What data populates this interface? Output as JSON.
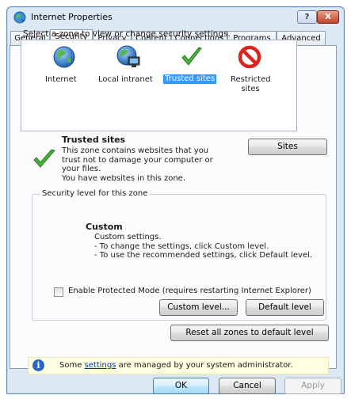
{
  "window": {
    "title": "Internet Properties",
    "help_label": "?",
    "close_label": "X"
  },
  "tabs": [
    {
      "label": "General"
    },
    {
      "label": "Security"
    },
    {
      "label": "Privacy"
    },
    {
      "label": "Content"
    },
    {
      "label": "Connections"
    },
    {
      "label": "Programs"
    },
    {
      "label": "Advanced"
    }
  ],
  "zone_prompt": "Select a zone to view or change security settings.",
  "zones": [
    {
      "label": "Internet",
      "icon": "globe-icon"
    },
    {
      "label": "Local intranet",
      "icon": "intranet-icon"
    },
    {
      "label": "Trusted sites",
      "icon": "checkmark-icon"
    },
    {
      "label": "Restricted sites",
      "icon": "restricted-icon"
    }
  ],
  "selected_zone": {
    "title": "Trusted sites",
    "desc": [
      "This zone contains websites that you",
      "trust not to damage your computer or",
      "your files."
    ],
    "count": "You have websites in this zone.",
    "sites_button": "Sites"
  },
  "security_level": {
    "legend": "Security level for this zone",
    "title": "Custom",
    "lines": [
      "Custom settings.",
      "- To change the settings, click Custom level.",
      "- To use the recommended settings, click Default level."
    ]
  },
  "protected_mode": {
    "label": "Enable Protected Mode (requires restarting Internet Explorer)",
    "checked": false
  },
  "buttons": {
    "custom_level": "Custom level...",
    "default_level": "Default level",
    "reset_all": "Reset all zones to default level",
    "ok": "OK",
    "cancel": "Cancel",
    "apply": "Apply"
  },
  "info": {
    "before": "Some ",
    "link": "settings",
    "after": " are managed by your system administrator."
  },
  "colors": {
    "selection": "#3399ff",
    "info_bg": "#ffffe1",
    "check_green": "#4caf3c",
    "restricted_red": "#d9251d"
  }
}
